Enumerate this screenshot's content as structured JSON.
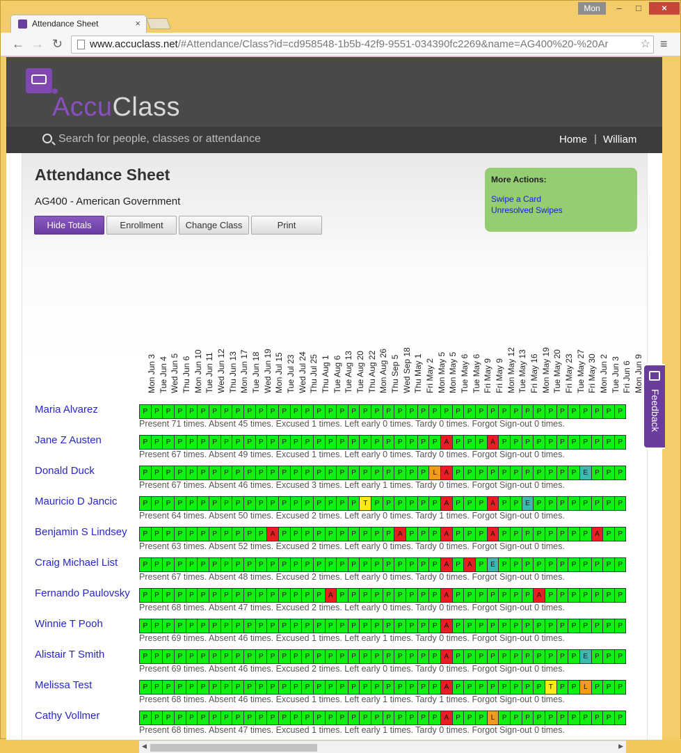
{
  "browser": {
    "tab_title": "Attendance Sheet",
    "tab_close": "×",
    "user_badge": "Mon",
    "min": "–",
    "max": "□",
    "close": "×",
    "back": "←",
    "forward": "→",
    "reload": "↻",
    "url_host": "www.accuclass.net",
    "url_path": "/#Attendance/Class?id=cd958548-1b5b-42f9-9551-034390fc2269&name=AG400%20-%20Ar",
    "star": "☆",
    "menu": "≡"
  },
  "header": {
    "logo_a": "Accu",
    "logo_b": "Class",
    "search_placeholder": "Search for people, classes or attendance",
    "nav_home": "Home",
    "nav_sep": "|",
    "nav_user": "William"
  },
  "page": {
    "title": "Attendance Sheet",
    "class_name": "AG400 - American Government",
    "buttons": {
      "hide_totals": "Hide Totals",
      "enrollment": "Enrollment",
      "change_class": "Change Class",
      "print": "Print"
    },
    "more_actions": {
      "heading": "More Actions:",
      "swipe": "Swipe a Card",
      "unresolved": "Unresolved Swipes"
    },
    "feedback": "Feedback"
  },
  "dates": [
    "Mon Jun 3",
    "Tue Jun 4",
    "Wed Jun 5",
    "Thu Jun 6",
    "Mon Jun 10",
    "Tue Jun 11",
    "Wed Jun 12",
    "Thu Jun 13",
    "Mon Jun 17",
    "Tue Jun 18",
    "Wed Jun 19",
    "Mon Jul 15",
    "Tue Jul 23",
    "Wed Jul 24",
    "Thu Jul 25",
    "Thu Aug 1",
    "Tue Aug 6",
    "Tue Aug 13",
    "Tue Aug 20",
    "Thu Aug 22",
    "Mon Aug 26",
    "Thu Sep 5",
    "Wed Sep 18",
    "Thu May 1",
    "Fri May 2",
    "Mon May 5",
    "Mon May 5",
    "Tue May 6",
    "Tue May 6",
    "Fri May 9",
    "Fri May 9",
    "Mon May 12",
    "Tue May 13",
    "Fri May 16",
    "Mon May 19",
    "Tue May 20",
    "Fri May 23",
    "Tue May 27",
    "Fri May 30",
    "Mon Jun 2",
    "Tue Jun 3",
    "Fri Jun 6",
    "Mon Jun 9"
  ],
  "students": [
    {
      "name": "Maria Alvarez",
      "marks": "PPPPPPPPPPPPPPPPPPPPPPPPPPPPPPPPPPPPPPPPPPP",
      "totals": "Present 71 times. Absent 45 times. Excused 1 times. Left early 0 times. Tardy 0 times. Forgot Sign-out 0 times."
    },
    {
      "name": "Jane Z Austen",
      "marks": "PPPPPPPPPPPPPPPPPPPPPPPPPPAPPPAPPPPPPPPPPPP",
      "totals": "Present 67 times. Absent 49 times. Excused 1 times. Left early 0 times. Tardy 0 times. Forgot Sign-out 0 times."
    },
    {
      "name": "Donald Duck",
      "marks": "PPPPPPPPPPPPPPPPPPPPPPPPPLAPPPPPPPPPPPEPPPP",
      "totals": "Present 67 times. Absent 46 times. Excused 3 times. Left early 1 times. Tardy 0 times. Forgot Sign-out 0 times."
    },
    {
      "name": "Mauricio D Jancic",
      "marks": "PPPPPPPPPPPPPPPPPPPTPPPPPPAPPPAPPEPPPPPPPPP",
      "totals": "Present 64 times. Absent 50 times. Excused 2 times. Left early 0 times. Tardy 1 times. Forgot Sign-out 0 times."
    },
    {
      "name": "Benjamin S Lindsey",
      "marks": "PPPPPPPPPPPAPPPPPPPPPPAPPPAPPPAPPPPPPPPAPPP",
      "totals": "Present 63 times. Absent 52 times. Excused 2 times. Left early 0 times. Tardy 0 times. Forgot Sign-out 0 times."
    },
    {
      "name": "Craig Michael List",
      "marks": "PPPPPPPPPPPPPPPPPPPPPPPPPPAPAPEPPPPPPPPPPPP",
      "totals": "Present 67 times. Absent 48 times. Excused 2 times. Left early 0 times. Tardy 0 times. Forgot Sign-out 0 times."
    },
    {
      "name": "Fernando Paulovsky",
      "marks": "PPPPPPPPPPPPPPPPAPPPPPPPPPAPPPPPPPAPPPPPPPP",
      "totals": "Present 68 times. Absent 47 times. Excused 2 times. Left early 0 times. Tardy 0 times. Forgot Sign-out 0 times."
    },
    {
      "name": "Winnie T Pooh",
      "marks": "PPPPPPPPPPPPPPPPPPPPPPPPPPAPPPPPPPPPPPPPPPP",
      "totals": "Present 69 times. Absent 46 times. Excused 1 times. Left early 1 times. Tardy 0 times. Forgot Sign-out 0 times."
    },
    {
      "name": "Alistair T Smith",
      "marks": "PPPPPPPPPPPPPPPPPPPPPPPPPPAPPPPPPPPPPPEPPPP",
      "totals": "Present 69 times. Absent 46 times. Excused 2 times. Left early 0 times. Tardy 0 times. Forgot Sign-out 0 times."
    },
    {
      "name": "Melissa Test",
      "marks": "PPPPPPPPPPPPPPPPPPPPPPPPPPAPPPPPPPPTPPLPPPP",
      "totals": "Present 68 times. Absent 46 times. Excused 1 times. Left early 1 times. Tardy 1 times. Forgot Sign-out 0 times."
    },
    {
      "name": "Cathy Vollmer",
      "marks": "PPPPPPPPPPPPPPPPPPPPPPPPPPAPPPLPPPPPPPPPPPP",
      "totals": "Present 68 times. Absent 47 times. Excused 1 times. Left early 1 times. Tardy 0 times. Forgot Sign-out 0 times."
    }
  ],
  "hscroll": {
    "left": "◀",
    "right": "▶"
  }
}
